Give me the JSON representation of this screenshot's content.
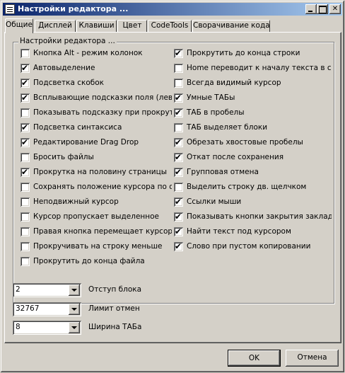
{
  "window": {
    "title": "Настройки редактора ..."
  },
  "tabs": [
    "Общие",
    "Дисплей",
    "Клавиши",
    "Цвет",
    "CodeTools",
    "Сворачивание кода"
  ],
  "group": {
    "label": "Настройки редактора ...",
    "left": [
      {
        "label": "Кнопка Alt - режим колонок",
        "checked": false
      },
      {
        "label": "Автовыделение",
        "checked": true
      },
      {
        "label": "Подсветка скобок",
        "checked": true
      },
      {
        "label": "Всплывающие подсказки поля (лев)",
        "checked": true
      },
      {
        "label": "Показывать подсказку при прокрутке",
        "checked": false
      },
      {
        "label": "Подсветка синтаксиса",
        "checked": true
      },
      {
        "label": "Редактирование Drag Drop",
        "checked": true
      },
      {
        "label": "Бросить файлы",
        "checked": false
      },
      {
        "label": "Прокрутка на половину страницы",
        "checked": true
      },
      {
        "label": "Сохранять положение курсора по оси X",
        "checked": false
      },
      {
        "label": "Неподвижный курсор",
        "checked": false
      },
      {
        "label": "Курсор пропускает выделенное",
        "checked": false
      },
      {
        "label": "Правая кнопка перемещает курсор",
        "checked": false
      },
      {
        "label": "Прокручивать на строку меньше",
        "checked": false
      },
      {
        "label": "Прокрутить до конца файла",
        "checked": false
      }
    ],
    "right": [
      {
        "label": "Прокрутить до конца строки",
        "checked": true
      },
      {
        "label": "Home переводит к началу текста в строке",
        "checked": false
      },
      {
        "label": "Всегда видимый курсор",
        "checked": false
      },
      {
        "label": "Умные ТАБы",
        "checked": true
      },
      {
        "label": "ТАБ в пробелы",
        "checked": true
      },
      {
        "label": "ТАБ выделяет блоки",
        "checked": false
      },
      {
        "label": "Обрезать хвостовые пробелы",
        "checked": true
      },
      {
        "label": "Откат после сохранения",
        "checked": true
      },
      {
        "label": "Групповая отмена",
        "checked": true
      },
      {
        "label": "Выделить строку дв. щелчком",
        "checked": false
      },
      {
        "label": "Ссылки мыши",
        "checked": true
      },
      {
        "label": "Показывать кнопки закрытия закладок",
        "checked": true
      },
      {
        "label": "Найти текст под курсором",
        "checked": true
      },
      {
        "label": "Слово при пустом копировании",
        "checked": true
      }
    ]
  },
  "combos": [
    {
      "value": "2",
      "label": "Отступ блока"
    },
    {
      "value": "32767",
      "label": "Лимит отмен"
    },
    {
      "value": "8",
      "label": "Ширина ТАБа"
    }
  ],
  "buttons": {
    "ok": "OK",
    "cancel": "Отмена"
  },
  "icons": {
    "check": "✔",
    "titlebar": "window-app-icon",
    "minimize": "minimize-icon",
    "maximize": "maximize-icon",
    "close": "close-icon",
    "dropdown": "chevron-down-icon"
  },
  "colors": {
    "titlebar_start": "#0a246a",
    "titlebar_end": "#a6caf0",
    "face": "#d4d0c8"
  }
}
